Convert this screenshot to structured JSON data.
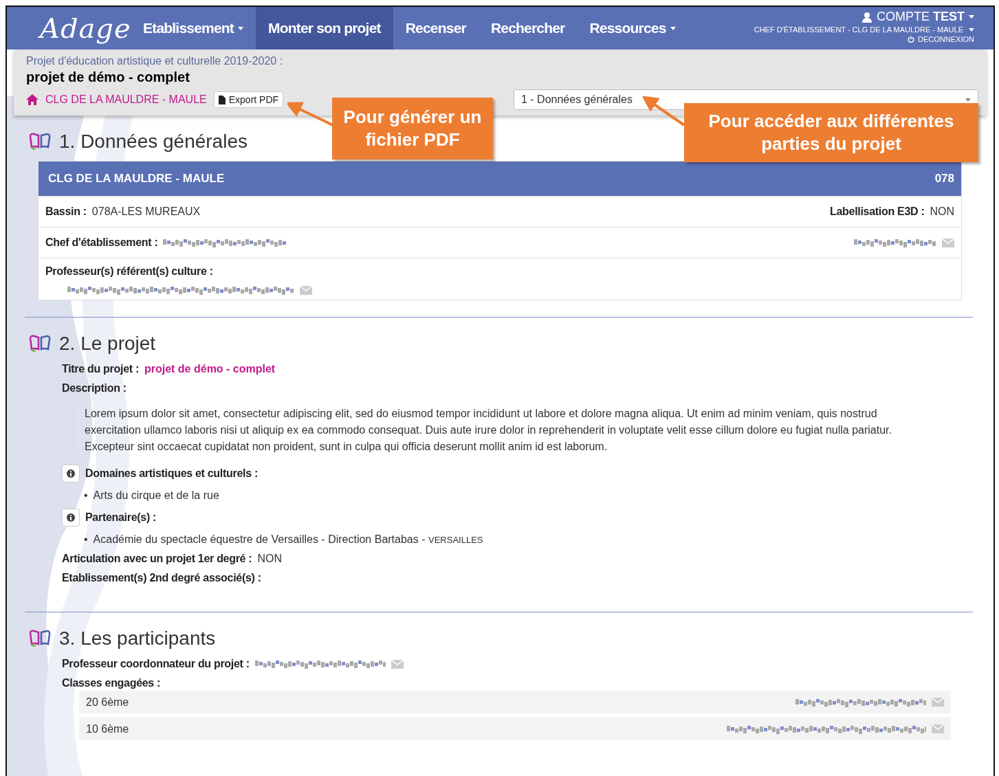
{
  "navbar": {
    "logo": "Adage",
    "items": [
      {
        "label": "Etablissement",
        "dropdown": true,
        "selected": false
      },
      {
        "label": "Monter son projet",
        "dropdown": false,
        "selected": true
      },
      {
        "label": "Recenser",
        "dropdown": false,
        "selected": false
      },
      {
        "label": "Rechercher",
        "dropdown": false,
        "selected": false
      },
      {
        "label": "Ressources",
        "dropdown": true,
        "selected": false
      }
    ],
    "account": {
      "label": "COMPTE",
      "name": "TEST",
      "role": "CHEF D'ÉTABLISSEMENT - CLG DE LA MAULDRE - MAULE",
      "logout": "DECONNEXION"
    }
  },
  "project_header": {
    "subtitle": "Projet d'éducation artistique et culturelle 2019-2020 :",
    "title": "projet de démo - complet",
    "school": "CLG DE LA MAULDRE - MAULE",
    "export_button": "Export PDF",
    "section_select": {
      "value": "1 - Données générales"
    }
  },
  "callouts": [
    {
      "text": "Pour générer un fichier PDF"
    },
    {
      "text": "Pour accéder aux différentes parties du projet"
    }
  ],
  "general": {
    "title": "1. Données générales",
    "card": {
      "name": "CLG DE LA MAULDRE - MAULE",
      "code": "078"
    },
    "bassin": {
      "label": "Bassin :",
      "value": "078A-LES MUREAUX"
    },
    "e3d": {
      "label": "Labellisation E3D :",
      "value": "NON"
    },
    "chef": {
      "label": "Chef d'établissement :"
    },
    "referents": {
      "label": "Professeur(s) référent(s) culture :"
    }
  },
  "project": {
    "title": "2. Le projet",
    "project_title": {
      "label": "Titre du projet :",
      "value": "projet de démo - complet"
    },
    "description": {
      "label": "Description :",
      "text": "Lorem ipsum dolor sit amet, consectetur adipiscing elit, sed do eiusmod tempor incididunt ut labore et dolore magna aliqua. Ut enim ad minim veniam, quis nostrud exercitation ullamco laboris nisi ut aliquip ex ea commodo consequat. Duis aute irure dolor in reprehenderit in voluptate velit esse cillum dolore eu fugiat nulla pariatur. Excepteur sint occaecat cupidatat non proident, sunt in culpa qui officia deserunt mollit anim id est laborum."
    },
    "domains": {
      "label": "Domaines artistiques et culturels :",
      "bullet": "•",
      "items": [
        "Arts du cirque et de la rue"
      ]
    },
    "partners": {
      "label": "Partenaire(s) :",
      "bullet": "•",
      "items": [
        {
          "name": "Académie du spectacle équestre de Versailles - Direction Bartabas -",
          "city": "VERSAILLES"
        }
      ]
    },
    "articulation": {
      "label": "Articulation avec un projet 1er degré :",
      "value": "NON"
    },
    "associated": {
      "label": "Etablissement(s) 2nd degré associé(s) :"
    }
  },
  "participants": {
    "title": "3. Les participants",
    "coordinator": {
      "label": "Professeur coordonnateur du projet :"
    },
    "classes": {
      "label": "Classes engagées :",
      "items": [
        "20 6ème",
        "10 6ème"
      ]
    }
  }
}
